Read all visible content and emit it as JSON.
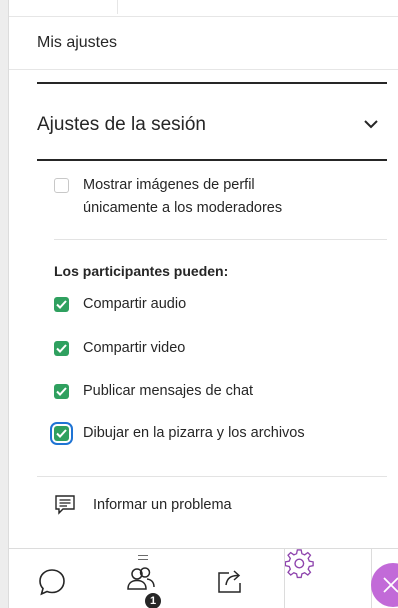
{
  "header": {
    "title": "Mis ajustes"
  },
  "session": {
    "title": "Ajustes de la sesión",
    "show_profile_pictures": {
      "label_line1": "Mostrar imágenes de perfil",
      "label_line2": "únicamente a los moderadores",
      "checked": false
    },
    "participants_label": "Los participantes pueden:",
    "permissions": [
      {
        "label": "Compartir audio",
        "checked": true
      },
      {
        "label": "Compartir video",
        "checked": true
      },
      {
        "label": "Publicar mensajes de chat",
        "checked": true
      },
      {
        "label": "Dibujar en la pizarra y los archivos",
        "checked": true,
        "focused": true
      }
    ]
  },
  "report": {
    "label": "Informar un problema"
  },
  "toolbar": {
    "attendees_badge": "1",
    "items": [
      "chat-icon",
      "attendees-icon",
      "share-icon",
      "settings-icon",
      "close-icon"
    ]
  },
  "colors": {
    "accent_green": "#2fa05f",
    "focus_blue": "#1f74d4",
    "active_purple": "#8e44ad",
    "close_purple": "#c26ad8"
  }
}
